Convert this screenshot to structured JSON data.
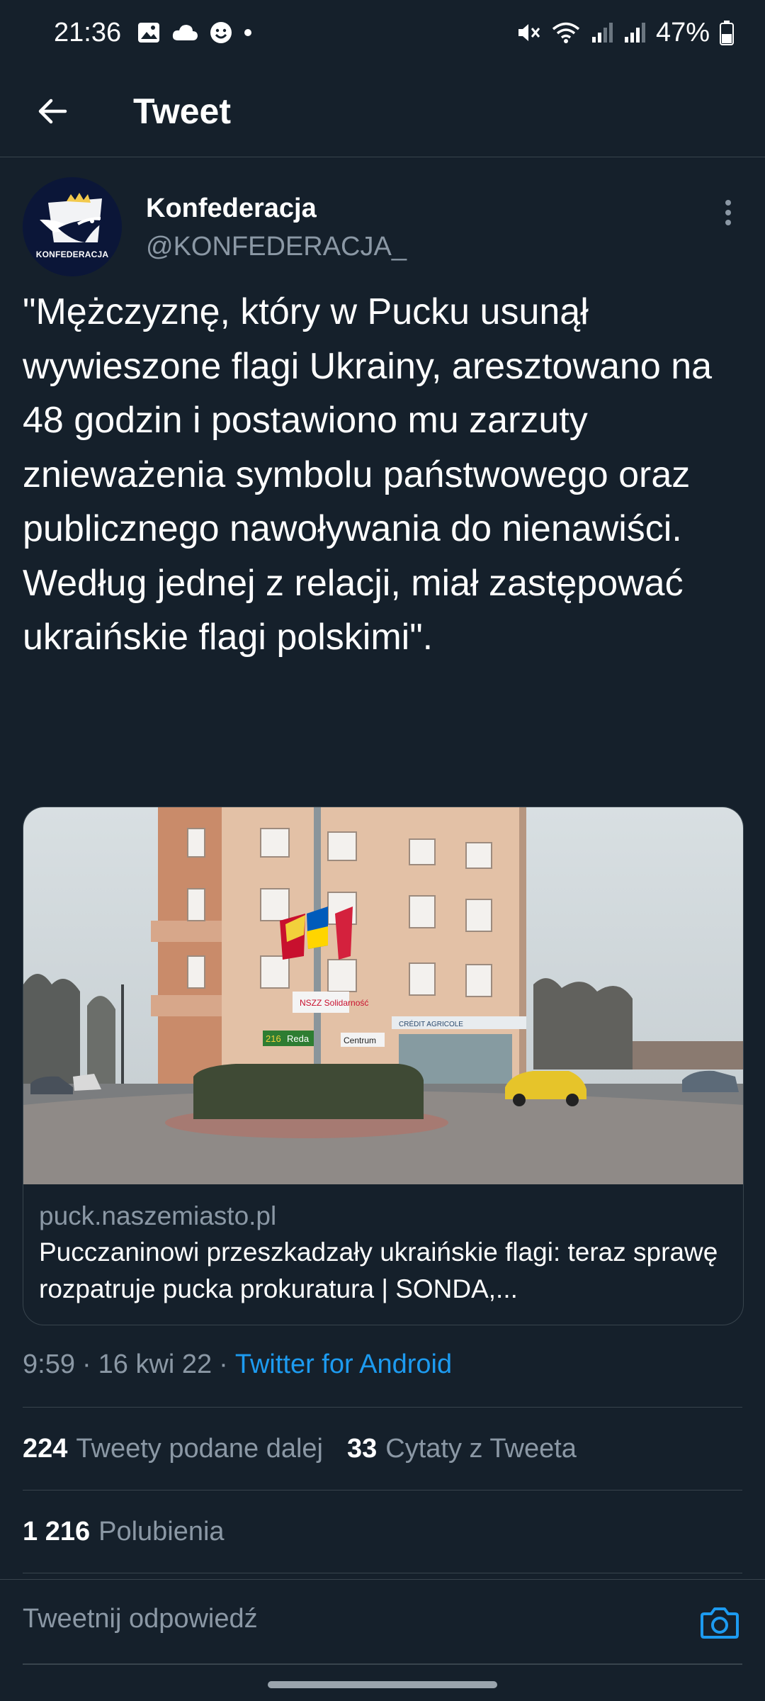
{
  "status_bar": {
    "time": "21:36",
    "battery": "47%",
    "left_icons": [
      "gallery-icon",
      "cloud-icon",
      "face-icon",
      "dot-icon"
    ],
    "right_icons": [
      "mute-icon",
      "wifi-icon",
      "signal-icon",
      "signal-icon",
      "battery-icon"
    ]
  },
  "header": {
    "title": "Tweet"
  },
  "tweet": {
    "author_name": "Konfederacja",
    "author_handle": "@KONFEDERACJA_",
    "avatar_label": "KONFEDERACJA",
    "text": "\"Mężczyznę, który w Pucku usunął wywieszone flagi Ukrainy, aresztowano na 48 godzin i postawiono mu zarzuty znieważenia symbolu państwowego oraz publicznego nawoływania do nienawiści. Według jednej z relacji, miał zastępować ukraińskie flagi polskimi\".",
    "card": {
      "domain": "puck.naszemiasto.pl",
      "title": "Pucczaninowi przeszkadzały ukraińskie flagi: teraz sprawę rozpatruje pucka prokuratura | SONDA,...",
      "image_signs": {
        "shop": "CRÉDIT AGRICOLE",
        "direction_left": "Reda",
        "direction_right": "Centrum",
        "road_number": "216",
        "poster": "NSZZ Solidarność"
      }
    },
    "time": "9:59",
    "date": "16 kwi 22",
    "source": "Twitter for Android",
    "retweets_count": "224",
    "retweets_label": "Tweety podane dalej",
    "quotes_count": "33",
    "quotes_label": "Cytaty z Tweeta",
    "likes_count": "1 216",
    "likes_label": "Polubienia"
  },
  "reply": {
    "placeholder": "Tweetnij odpowiedź"
  },
  "colors": {
    "background": "#15202b",
    "muted_text": "#8b98a5",
    "accent": "#1d9bf0",
    "divider": "#38444d"
  }
}
